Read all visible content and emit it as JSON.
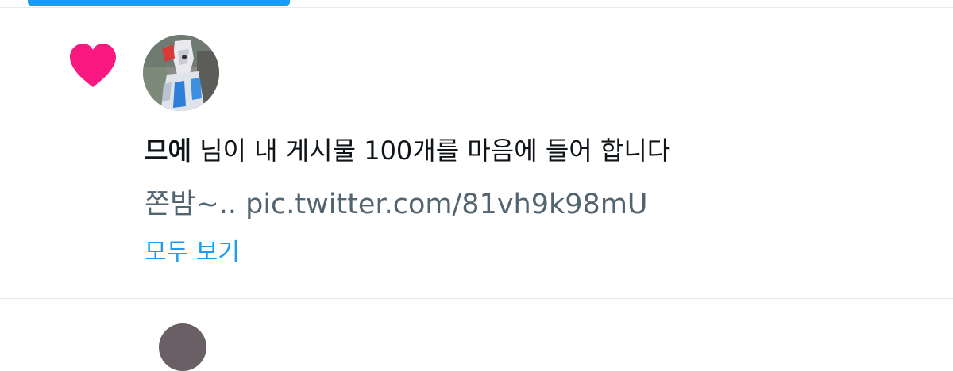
{
  "notification": {
    "type_icon": "heart-icon",
    "type_color": "#f91880",
    "avatar_icon": "user-avatar",
    "user_name": "므에",
    "message": " 님이 내 게시물 100개를 마음에 들어 합니다",
    "tweet_preview": "쫀밤~.. pic.twitter.com/81vh9k98mU",
    "show_all_label": "모두 보기"
  },
  "colors": {
    "accent": "#1d9bf0",
    "heart": "#f91880",
    "text_primary": "#0f1419",
    "text_secondary": "#536471",
    "divider": "#e7e9ea"
  }
}
